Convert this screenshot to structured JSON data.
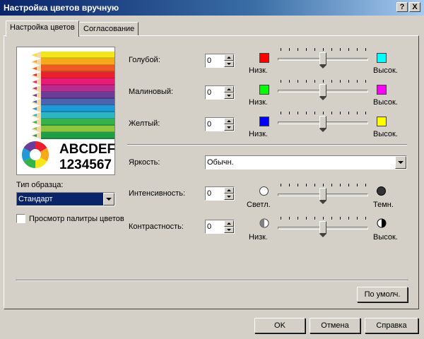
{
  "window": {
    "title": "Настройка цветов вручную",
    "help_label": "?",
    "close_label": "X"
  },
  "tabs": [
    {
      "label": "Настройка цветов",
      "active": true
    },
    {
      "label": "Согласование",
      "active": false
    }
  ],
  "sample": {
    "text_letters": "ABCDEF",
    "text_digits": "1234567",
    "type_label": "Тип образца:",
    "type_value": "Стандарт",
    "palette_checkbox_label": "Просмотр палитры цветов",
    "palette_checkbox_checked": false,
    "pencil_colors": [
      "#f5e61a",
      "#f7a81b",
      "#ef5a24",
      "#e8202f",
      "#e81c78",
      "#b52d8f",
      "#6a3d98",
      "#4a64b0",
      "#1e9ad6",
      "#2cb6c2",
      "#36b24a",
      "#8cc63e",
      "#1f9e48"
    ]
  },
  "color_sliders": [
    {
      "label": "Голубой:",
      "value": "0",
      "low_label": "Низк.",
      "high_label": "Высок.",
      "low_color": "#ff0000",
      "high_color": "#00ffff",
      "position": 0.5
    },
    {
      "label": "Малиновый:",
      "value": "0",
      "low_label": "Низк.",
      "high_label": "Высок.",
      "low_color": "#00ff00",
      "high_color": "#ff00ff",
      "position": 0.5
    },
    {
      "label": "Желтый:",
      "value": "0",
      "low_label": "Низк.",
      "high_label": "Высок.",
      "low_color": "#0000ff",
      "high_color": "#ffff00",
      "position": 0.5
    }
  ],
  "brightness": {
    "label": "Яркость:",
    "value": "Обычн."
  },
  "intensity": {
    "label": "Интенсивность:",
    "value": "0",
    "low_label": "Светл.",
    "high_label": "Темн.",
    "low_icon": "light-circle-icon",
    "high_icon": "dark-circle-icon",
    "position": 0.5
  },
  "contrast": {
    "label": "Контрастность:",
    "value": "0",
    "low_label": "Низк.",
    "high_label": "Высок.",
    "low_icon": "low-contrast-icon",
    "high_icon": "high-contrast-icon",
    "position": 0.5
  },
  "buttons": {
    "defaults": "По умолч.",
    "ok": "OK",
    "cancel": "Отмена",
    "help": "Справка"
  }
}
